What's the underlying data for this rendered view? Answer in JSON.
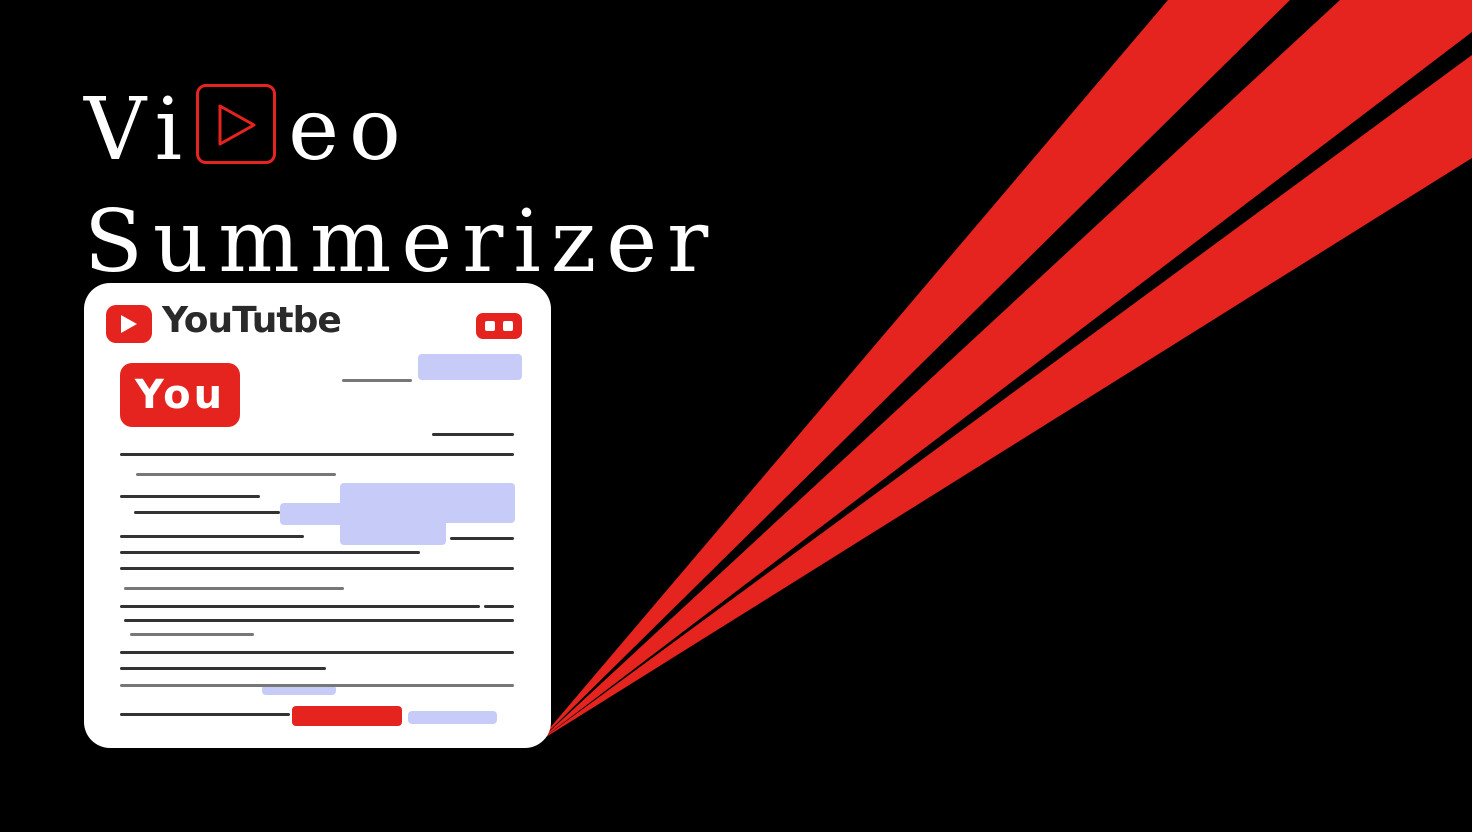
{
  "title": {
    "line1_prefix": "Vi",
    "line1_suffix": "eo",
    "line2": "Summerizer"
  },
  "card": {
    "brand_label": "YouTutbe",
    "badge_label": "You"
  },
  "colors": {
    "background": "#000000",
    "accent": "#e52420",
    "card": "#ffffff",
    "highlight": "#c6cbf8"
  },
  "icons": [
    "play-icon",
    "youtube-logo-icon",
    "menu-icon"
  ]
}
